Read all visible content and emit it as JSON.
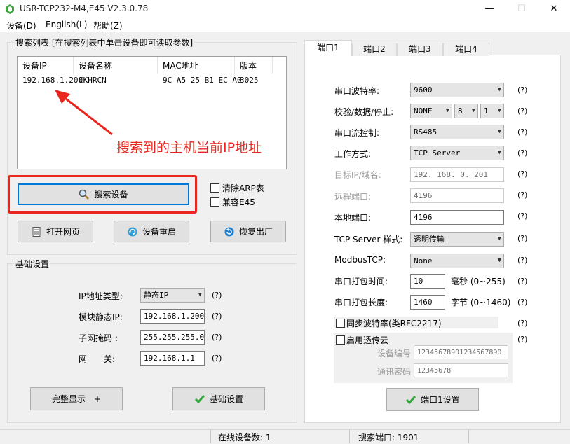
{
  "window": {
    "title": "USR-TCP232-M4,E45 V2.3.0.78",
    "minimize": "—",
    "maximize": "☐",
    "close": "✕"
  },
  "menu": [
    "设备(D)",
    "English(L)",
    "帮助(Z)"
  ],
  "search_group": {
    "title": "搜索列表 [在搜索列表中单击设备即可读取参数]",
    "columns": [
      "设备IP",
      "设备名称",
      "MAC地址",
      "版本"
    ],
    "rows": [
      {
        "ip": "192.168.1.200",
        "name": "CKHRCN",
        "mac": "9C A5 25 B1 EC A0",
        "version": "3025"
      }
    ],
    "annotation": "搜索到的主机当前IP地址",
    "search_button": "搜索设备",
    "clear_arp": "清除ARP表",
    "compat_e45": "兼容E45",
    "open_web_button": "打开网页",
    "restart_button": "设备重启",
    "restore_button": "恢复出厂"
  },
  "basic_group": {
    "title": "基础设置",
    "ip_type_label": "IP地址类型:",
    "ip_type_value": "静态IP",
    "static_ip_label": "模块静态IP:",
    "static_ip_value": "192.168.1.200",
    "subnet_label": "子网掩码 :",
    "subnet_value": "255.255.255.0",
    "gateway_label": "网　　关:",
    "gateway_value": "192.168.1.1",
    "help": "(?)",
    "full_display_button": "完整显示　+",
    "basic_settings_button": "基础设置"
  },
  "tabs": [
    "端口1",
    "端口2",
    "端口3",
    "端口4"
  ],
  "port": {
    "baud_label": "串口波特率:",
    "baud_value": "9600",
    "parity_label": "校验/数据/停止:",
    "parity_value": "NONE",
    "data_value": "8",
    "stop_value": "1",
    "flow_label": "串口流控制:",
    "flow_value": "RS485",
    "mode_label": "工作方式:",
    "mode_value": "TCP Server",
    "target_label": "目标IP/域名:",
    "target_value": "192. 168. 0. 201",
    "remote_port_label": "远程端口:",
    "remote_port_value": "4196",
    "local_port_label": "本地端口:",
    "local_port_value": "4196",
    "server_style_label": "TCP Server 样式:",
    "server_style_value": "透明传输",
    "modbus_label": "ModbusTCP:",
    "modbus_value": "None",
    "pack_time_label": "串口打包时间:",
    "pack_time_value": "10",
    "pack_time_unit": "毫秒 (0~255)",
    "pack_len_label": "串口打包长度:",
    "pack_len_value": "1460",
    "pack_len_unit": "字节 (0~1460)",
    "sync_baud": "同步波特率(类RFC2217)",
    "cloud": "启用透传云",
    "device_no_label": "设备编号",
    "device_no_value": "12345678901234567890",
    "comm_pwd_label": "通讯密码",
    "comm_pwd_value": "12345678",
    "help": "(?)",
    "apply_button": "端口1设置"
  },
  "status": {
    "online": "在线设备数: 1",
    "search_port": "搜索端口: 1901"
  },
  "colors": {
    "annotation_red": "#e8261e",
    "selection_border": "#0078d7",
    "check_green": "#2ea836"
  }
}
